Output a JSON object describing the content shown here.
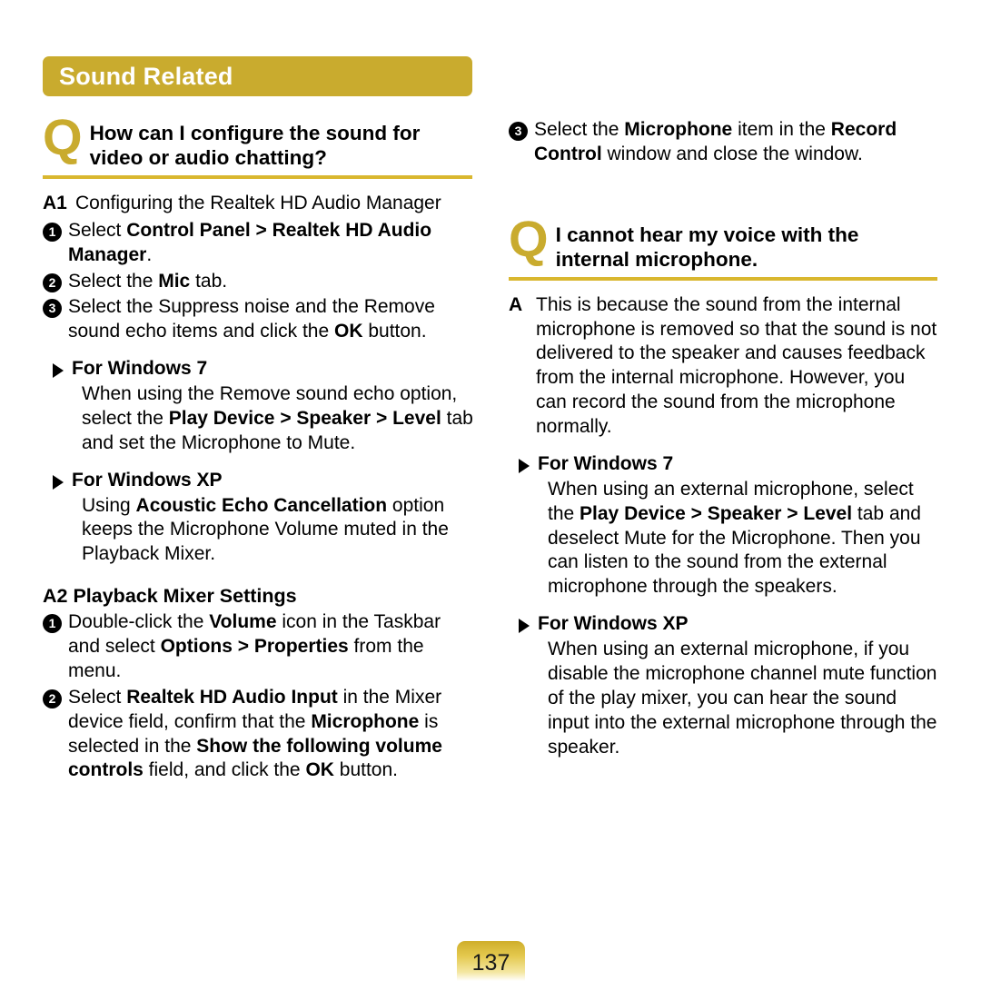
{
  "section": {
    "title": "Sound Related",
    "bar_color": "#c9ab2e",
    "rule_color": "#d9b72f"
  },
  "left_column": {
    "question": {
      "marker": "Q",
      "line1": "How can I configure the sound for",
      "line2": "video or audio chatting?"
    },
    "answer1": {
      "label": "A1",
      "text": "Configuring the Realtek HD Audio Manager"
    },
    "steps": [
      {
        "num": "1",
        "text_html": "Select <b>Control Panel &gt; Realtek HD Audio Manager</b>."
      },
      {
        "num": "2",
        "text_html": "Select the <b>Mic</b> tab."
      },
      {
        "num": "3",
        "text_html": "Select the Suppress noise and the Remove sound echo items and click the <b>OK</b> button."
      }
    ],
    "win7": {
      "heading": "For Windows 7",
      "body_html": "When using the Remove sound echo option, select the <b>Play Device &gt; Speaker &gt; Level</b> tab and set the Microphone to Mute."
    },
    "winxp": {
      "heading": "For Windows XP",
      "body_html": "Using <b>Acoustic Echo Cancellation</b> option keeps the Microphone Volume muted in the Playback Mixer."
    },
    "answer2": {
      "label": "A2",
      "heading": "A2 Playback Mixer Settings",
      "title": "Playback Mixer Settings"
    },
    "steps2": [
      {
        "num": "1",
        "text_html": "Double-click the <b>Volume</b> icon in the Taskbar and select <b>Options &gt; Properties</b> from the menu."
      },
      {
        "num": "2",
        "text_html": "Select <b>Realtek HD Audio Input</b> in the Mixer device field, confirm that the <b>Microphone</b> is selected in the <b>Show the following volume controls</b> field, and click the <b>OK</b> button."
      }
    ]
  },
  "right_column": {
    "step3": {
      "num": "3",
      "text_html": "Select the <b>Microphone</b> item in the <b>Record Control</b> window and close the window."
    },
    "question": {
      "marker": "Q",
      "line1": "I cannot hear my voice with the",
      "line2": "internal microphone."
    },
    "answer": {
      "label": "A",
      "text": "This is because the sound from the internal microphone is removed so that the sound is not delivered to the speaker and causes feedback from the internal microphone. However, you can record the sound from the microphone normally."
    },
    "win7": {
      "heading": "For Windows 7",
      "body_html": "When using an external microphone, select the <b>Play Device &gt; Speaker &gt; Level</b> tab and deselect Mute for the Microphone. Then you can listen to the sound from the external microphone through the speakers."
    },
    "winxp": {
      "heading": "For Windows XP",
      "body_html": "When using an external microphone, if you disable the microphone channel mute function of the play mixer, you can hear the sound input into the external microphone through the speaker."
    }
  },
  "footer": {
    "page_number": "137"
  }
}
